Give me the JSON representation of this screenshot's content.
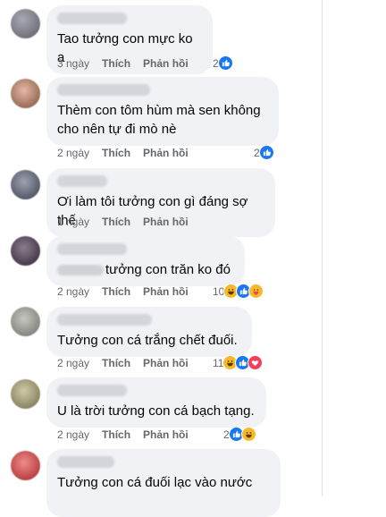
{
  "comments": [
    {
      "text": "Tao tưởng con mực ko a",
      "time": "3 ngày",
      "like_label": "Thích",
      "reply_label": "Phản hồi",
      "reactions": "2",
      "reaction_icons": [
        "like"
      ]
    },
    {
      "text": "Thèm con tôm hùm mà sen không cho nên tự đi mò nè",
      "time": "2 ngày",
      "like_label": "Thích",
      "reply_label": "Phản hồi",
      "reactions": "2",
      "reaction_icons": [
        "like"
      ]
    },
    {
      "text": "Ơi làm tôi tưởng con gì đáng sợ thế",
      "time": "1 ngày",
      "like_label": "Thích",
      "reply_label": "Phản hồi",
      "reactions": "",
      "reaction_icons": []
    },
    {
      "text": "tưởng con trăn ko đó",
      "time": "2 ngày",
      "like_label": "Thích",
      "reply_label": "Phản hồi",
      "reactions": "10",
      "reaction_icons": [
        "haha",
        "like",
        "care"
      ]
    },
    {
      "text": "Tưởng con cá trắng chết đuối.",
      "time": "2 ngày",
      "like_label": "Thích",
      "reply_label": "Phản hồi",
      "reactions": "11",
      "reaction_icons": [
        "haha",
        "like",
        "love"
      ]
    },
    {
      "text": "U là trời tưởng con cá bạch tạng.",
      "time": "2 ngày",
      "like_label": "Thích",
      "reply_label": "Phản hồi",
      "reactions": "2",
      "reaction_icons": [
        "like",
        "haha"
      ]
    },
    {
      "text": "Tưởng con cá đuối lạc vào nước",
      "time": "",
      "like_label": "",
      "reply_label": "",
      "reactions": "",
      "reaction_icons": []
    }
  ],
  "colors": {
    "bubble": "#f0f2f5",
    "meta": "#65676b",
    "like": "#1877f2",
    "haha": "#f7b928",
    "love": "#f33e58"
  }
}
